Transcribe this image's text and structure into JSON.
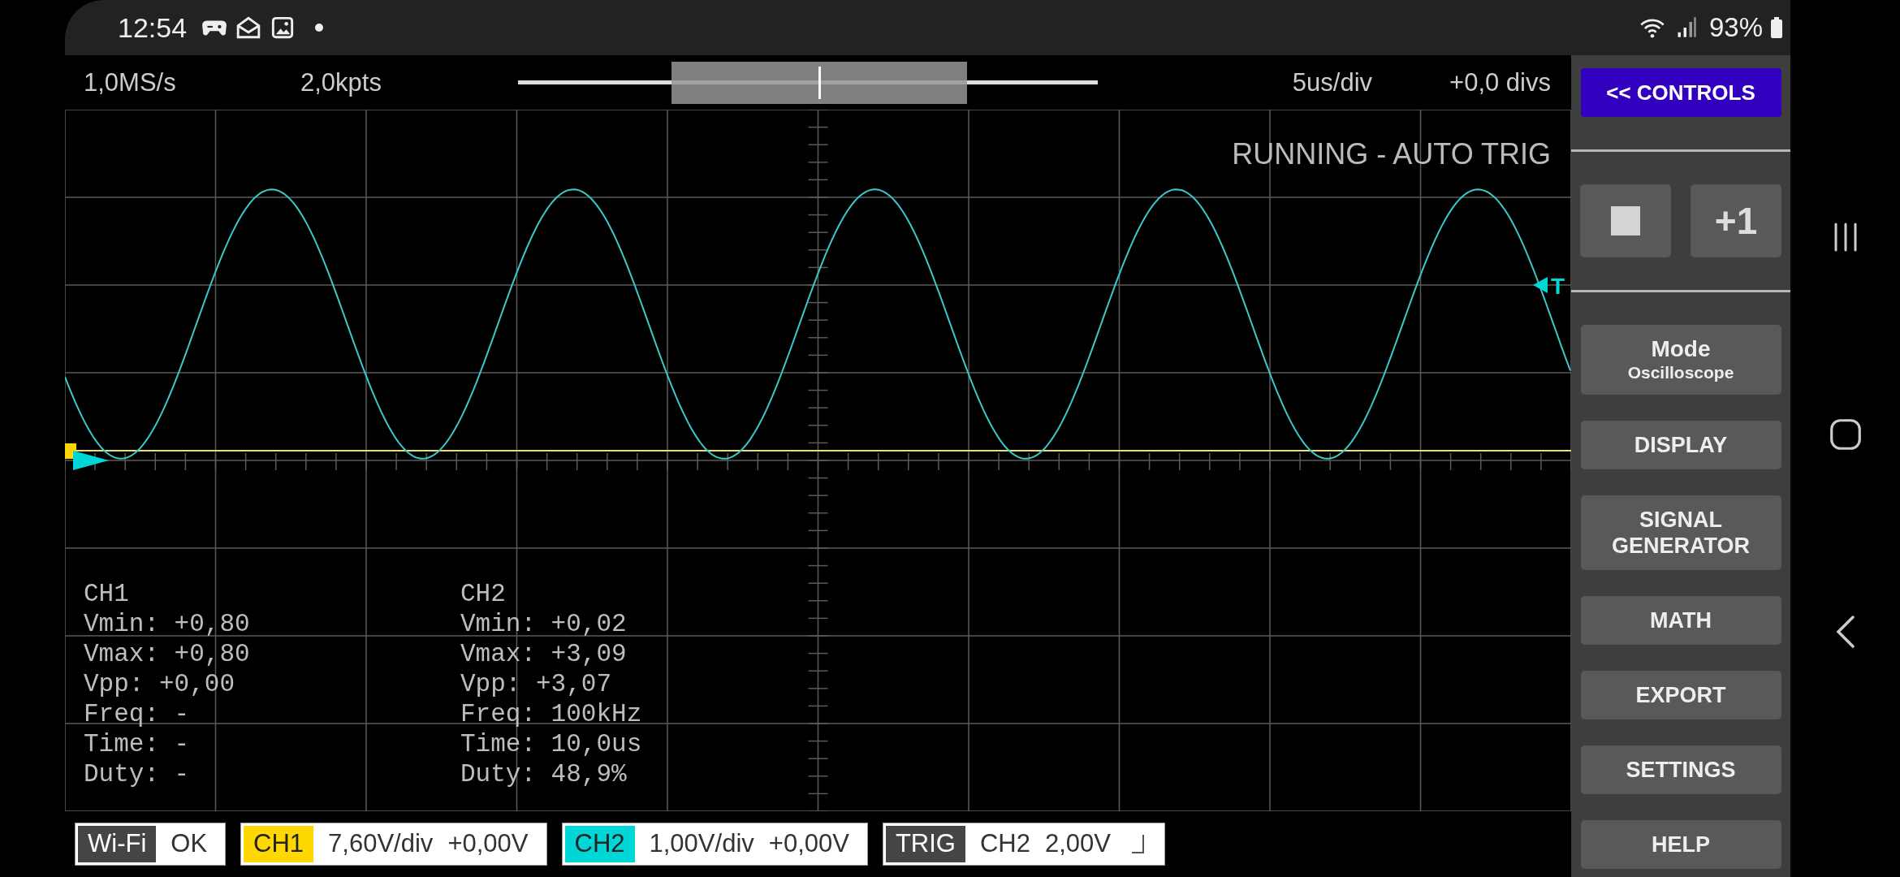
{
  "status_bar": {
    "time": "12:54",
    "battery": "93%"
  },
  "top_bar": {
    "sample_rate": "1,0MS/s",
    "points": "2,0kpts",
    "viewport": {
      "level": 0.52
    },
    "time_per_div": "5us/div",
    "offset": "+0,0 divs"
  },
  "scope": {
    "status": "RUNNING - AUTO TRIG",
    "trigger_marker": "T",
    "measurements": [
      {
        "channel": "CH1",
        "lines": [
          "Vmin: +0,80",
          "Vmax: +0,80",
          "Vpp: +0,00",
          "Freq: -",
          "Time: -",
          "Duty: -"
        ]
      },
      {
        "channel": "CH2",
        "lines": [
          "Vmin: +0,02",
          "Vmax: +3,09",
          "Vpp: +3,07",
          "Freq: 100kHz",
          "Time: 10,0us",
          "Duty: 48,9%"
        ]
      }
    ]
  },
  "bottom_bar": {
    "chips": [
      {
        "label": "Wi-Fi",
        "color": "#454545",
        "values": [
          "OK"
        ]
      },
      {
        "label": "CH1",
        "color": "#ffd800",
        "values": [
          "7,60V/div",
          "+0,00V"
        ]
      },
      {
        "label": "CH2",
        "color": "#00d6d6",
        "values": [
          "1,00V/div",
          "+0,00V"
        ]
      },
      {
        "label": "TRIG",
        "color": "#454545",
        "values": [
          "CH2",
          "2,00V"
        ],
        "rising_edge": true
      }
    ]
  },
  "controls": {
    "toggle": "<< CONTROLS",
    "run_buttons": [
      {
        "kind": "stop"
      },
      {
        "kind": "step",
        "label": "+1"
      }
    ],
    "menu": [
      {
        "label": "Mode",
        "sublabel": "Oscilloscope"
      },
      {
        "label": "DISPLAY"
      },
      {
        "label": "SIGNAL GENERATOR"
      },
      {
        "label": "MATH"
      },
      {
        "label": "EXPORT"
      },
      {
        "label": "SETTINGS"
      },
      {
        "label": "HELP"
      }
    ]
  }
}
